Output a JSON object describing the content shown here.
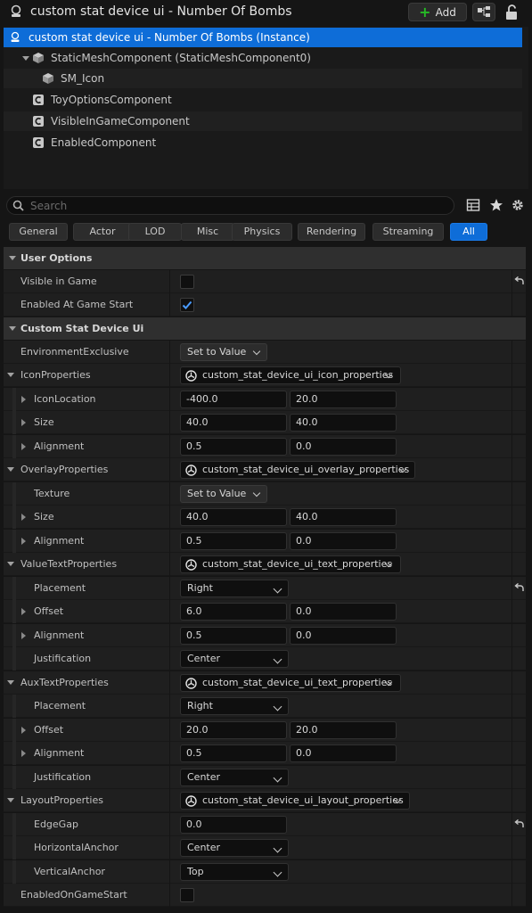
{
  "title": {
    "text": "custom stat device ui - Number Of Bombs",
    "add_label": "Add"
  },
  "tree": {
    "items": [
      {
        "label": "custom stat device ui - Number Of Bombs (Instance)",
        "icon": "actor-icon"
      },
      {
        "label": "StaticMeshComponent (StaticMeshComponent0)",
        "icon": "cube-icon"
      },
      {
        "label": "SM_Icon",
        "icon": "cube-icon"
      },
      {
        "label": "ToyOptionsComponent",
        "icon": "component-icon"
      },
      {
        "label": "VisibleInGameComponent",
        "icon": "component-icon"
      },
      {
        "label": "EnabledComponent",
        "icon": "component-icon"
      }
    ]
  },
  "search": {
    "placeholder": "Search"
  },
  "tabs": [
    "General",
    "Actor",
    "LOD",
    "Misc",
    "Physics",
    "Rendering",
    "Streaming",
    "All"
  ],
  "active_tab": "All",
  "sections": {
    "user_options": "User Options",
    "custom_stat_device_ui": "Custom Stat Device Ui"
  },
  "props": {
    "visible_in_game": {
      "label": "Visible in Game",
      "checked": false
    },
    "enabled_at_game_start": {
      "label": "Enabled At Game Start",
      "checked": true
    },
    "environment_exclusive": {
      "label": "EnvironmentExclusive",
      "value": "Set to Value"
    },
    "icon_properties": {
      "label": "IconProperties",
      "asset": "custom_stat_device_ui_icon_properties",
      "icon_location": {
        "label": "IconLocation",
        "x": "-400.0",
        "y": "20.0"
      },
      "size": {
        "label": "Size",
        "x": "40.0",
        "y": "40.0"
      },
      "alignment": {
        "label": "Alignment",
        "x": "0.5",
        "y": "0.0"
      }
    },
    "overlay_properties": {
      "label": "OverlayProperties",
      "asset": "custom_stat_device_ui_overlay_properties",
      "texture": {
        "label": "Texture",
        "value": "Set to Value"
      },
      "size": {
        "label": "Size",
        "x": "40.0",
        "y": "40.0"
      },
      "alignment": {
        "label": "Alignment",
        "x": "0.5",
        "y": "0.0"
      }
    },
    "value_text_properties": {
      "label": "ValueTextProperties",
      "asset": "custom_stat_device_ui_text_properties",
      "placement": {
        "label": "Placement",
        "value": "Right"
      },
      "offset": {
        "label": "Offset",
        "x": "6.0",
        "y": "0.0"
      },
      "alignment": {
        "label": "Alignment",
        "x": "0.5",
        "y": "0.0"
      },
      "justification": {
        "label": "Justification",
        "value": "Center"
      }
    },
    "aux_text_properties": {
      "label": "AuxTextProperties",
      "asset": "custom_stat_device_ui_text_properties",
      "placement": {
        "label": "Placement",
        "value": "Right"
      },
      "offset": {
        "label": "Offset",
        "x": "20.0",
        "y": "20.0"
      },
      "alignment": {
        "label": "Alignment",
        "x": "0.5",
        "y": "0.0"
      },
      "justification": {
        "label": "Justification",
        "value": "Center"
      }
    },
    "layout_properties": {
      "label": "LayoutProperties",
      "asset": "custom_stat_device_ui_layout_properties",
      "edge_gap": {
        "label": "EdgeGap",
        "value": "0.0"
      },
      "horizontal_anchor": {
        "label": "HorizontalAnchor",
        "value": "Center"
      },
      "vertical_anchor": {
        "label": "VerticalAnchor",
        "value": "Top"
      }
    },
    "enabled_on_game_start": {
      "label": "EnabledOnGameStart",
      "checked": false
    }
  }
}
